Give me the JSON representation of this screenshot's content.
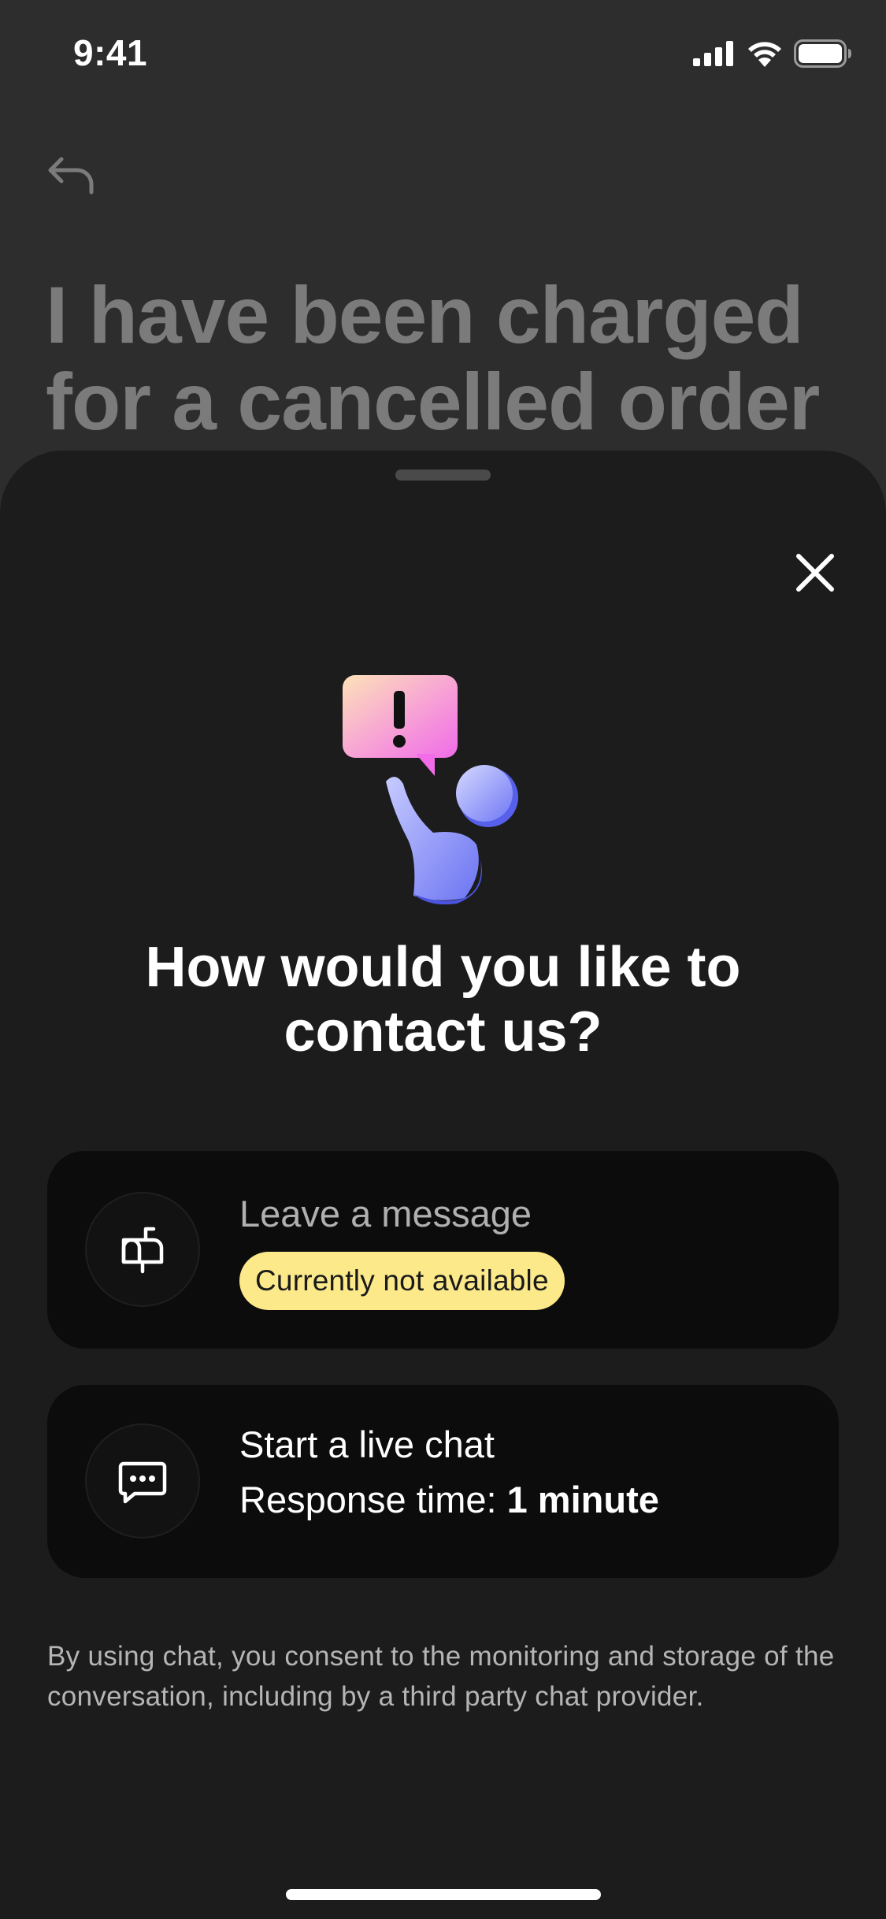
{
  "status_bar": {
    "time": "9:41",
    "icons": [
      "signal-icon",
      "wifi-icon",
      "battery-icon"
    ]
  },
  "background_page": {
    "back_icon": "back-arrow-icon",
    "title": "I have been charged for a cancelled order"
  },
  "sheet": {
    "close_icon": "close-icon",
    "illustration": "person-with-alert-bubble-illustration",
    "title": "How would you like to contact us?",
    "options": [
      {
        "icon": "mailbox-icon",
        "label": "Leave a message",
        "badge": "Currently not available"
      },
      {
        "icon": "chat-bubble-icon",
        "label": "Start a live chat",
        "response_prefix": "Response time:",
        "response_value": "1 minute"
      }
    ],
    "consent_text": "By using chat, you consent to the monitoring and storage of the conversation, including by a third party chat provider."
  },
  "colors": {
    "background": "#2d2d2d",
    "sheet": "#1c1c1c",
    "card": "#0c0c0c",
    "badge": "#fce98a",
    "illustration_pink": "#f47be6",
    "illustration_blue": "#6b74f2"
  }
}
